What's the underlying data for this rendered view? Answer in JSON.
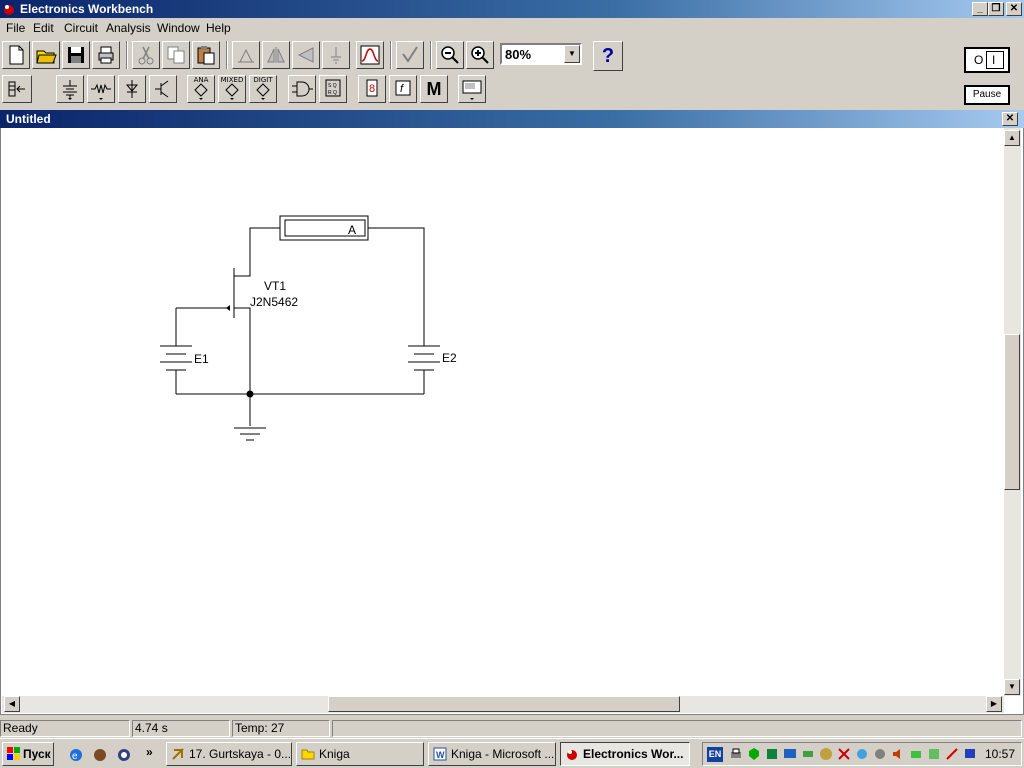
{
  "app": {
    "title": "Electronics Workbench",
    "caption_buttons": [
      "_",
      "❐",
      "✕"
    ]
  },
  "menu": [
    "File",
    "Edit",
    "Circuit",
    "Analysis",
    "Window",
    "Help"
  ],
  "toolbar": {
    "zoom_value": "80%",
    "help_label": "?",
    "parts_labels": {
      "analog": "ANA",
      "mixed": "MIXED",
      "digital": "DIGIT",
      "misc": "M",
      "func": "f"
    }
  },
  "power_switch": {
    "on_label": "O",
    "off_label": "I"
  },
  "pause_label": "Pause",
  "document": {
    "title": "Untitled",
    "close_label": "✕"
  },
  "circuit": {
    "transistor_ref": "VT1",
    "transistor_model": "J2N5462",
    "source1": "E1",
    "source2": "E2",
    "ammeter": "A"
  },
  "status": {
    "state": "Ready",
    "time": "4.74 s",
    "temp": "Temp:  27"
  },
  "taskbar": {
    "start": "Пуск",
    "chevron": "»",
    "tasks": [
      "17. Gurtskaya - 0...",
      "Kniga",
      "Kniga - Microsoft ...",
      "Electronics Wor..."
    ],
    "lang": "EN",
    "clock": "10:57"
  }
}
